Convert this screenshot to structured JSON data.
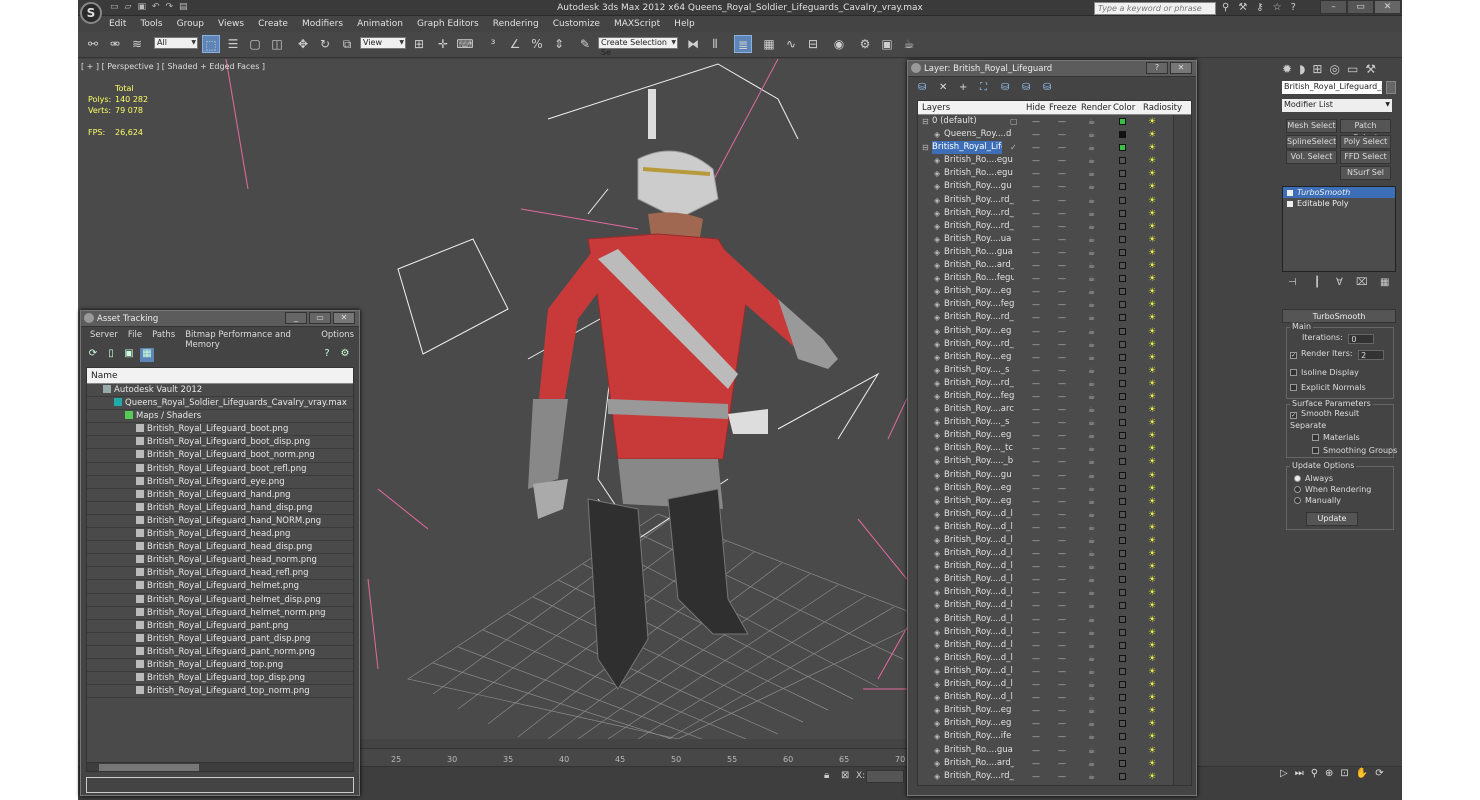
{
  "app": {
    "title": "Autodesk 3ds Max  2012 x64     Queens_Royal_Soldier_Lifeguards_Cavalry_vray.max",
    "search_placeholder": "Type a keyword or phrase",
    "menu": [
      "Edit",
      "Tools",
      "Group",
      "Views",
      "Create",
      "Modifiers",
      "Animation",
      "Graph Editors",
      "Rendering",
      "Customize",
      "MAXScript",
      "Help"
    ]
  },
  "toolbar": {
    "filter_value": "All",
    "refcoord_value": "View",
    "selection_set_value": "Create Selection Se"
  },
  "viewport": {
    "label": "[ + ] [ Perspective ] [ Shaded + Edged Faces ]",
    "stats": {
      "total_label": "Total",
      "polys_label": "Polys:",
      "polys_value": "140 282",
      "verts_label": "Verts:",
      "verts_value": "79 078",
      "fps_label": "FPS:",
      "fps_value": "26,624"
    }
  },
  "trackbar": {
    "ticks": [
      "25",
      "30",
      "35",
      "40",
      "45",
      "50",
      "55",
      "60",
      "65",
      "70",
      "75"
    ]
  },
  "statusbar": {
    "x_label": "X:",
    "y_label": "Y:",
    "z_label": "Z:"
  },
  "asset_tracking": {
    "title": "Asset Tracking",
    "menu": [
      "Server",
      "File",
      "Paths",
      "Bitmap Performance and Memory",
      "Options"
    ],
    "column_header": "Name",
    "vault": "Autodesk Vault 2012",
    "scene_file": "Queens_Royal_Soldier_Lifeguards_Cavalry_vray.max",
    "maps_folder": "Maps / Shaders",
    "files": [
      "British_Royal_Lifeguard_boot.png",
      "British_Royal_Lifeguard_boot_disp.png",
      "British_Royal_Lifeguard_boot_norm.png",
      "British_Royal_Lifeguard_boot_refl.png",
      "British_Royal_Lifeguard_eye.png",
      "British_Royal_Lifeguard_hand.png",
      "British_Royal_Lifeguard_hand_disp.png",
      "British_Royal_Lifeguard_hand_NORM.png",
      "British_Royal_Lifeguard_head.png",
      "British_Royal_Lifeguard_head_disp.png",
      "British_Royal_Lifeguard_head_norm.png",
      "British_Royal_Lifeguard_head_refl.png",
      "British_Royal_Lifeguard_helmet.png",
      "British_Royal_Lifeguard_helmet_disp.png",
      "British_Royal_Lifeguard_helmet_norm.png",
      "British_Royal_Lifeguard_pant.png",
      "British_Royal_Lifeguard_pant_disp.png",
      "British_Royal_Lifeguard_pant_norm.png",
      "British_Royal_Lifeguard_top.png",
      "British_Royal_Lifeguard_top_disp.png",
      "British_Royal_Lifeguard_top_norm.png"
    ]
  },
  "layer_window": {
    "title": "Layer: British_Royal_Lifeguard",
    "columns": {
      "layers": "Layers",
      "hide": "Hide",
      "freeze": "Freeze",
      "render": "Render",
      "color": "Color",
      "radiosity": "Radiosity"
    },
    "rows": [
      "0 (default)",
      "Queens_Roy....d",
      "British_Royal_Lifeg",
      "British_Ro....egu",
      "British_Ro....egu",
      "British_Roy....gu",
      "British_Roy....rd_",
      "British_Roy....rd_",
      "British_Roy....rd_",
      "British_Roy....ua",
      "British_Ro....gua",
      "British_Ro....ard_",
      "British_Ro....fegu",
      "British_Roy....eg",
      "British_Roy....feg",
      "British_Roy....rd_",
      "British_Roy....eg",
      "British_Roy....rd_",
      "British_Roy....eg",
      "British_Roy...._s",
      "British_Roy....rd_",
      "British_Roy....feg",
      "British_Roy....arc",
      "British_Roy...._s",
      "British_Roy....eg",
      "British_Roy...._tc",
      "British_Roy....._b",
      "British_Roy....gu",
      "British_Roy....eg",
      "British_Roy....eg",
      "British_Roy....d_l",
      "British_Roy....d_l",
      "British_Roy....d_l",
      "British_Roy....d_l",
      "British_Roy....d_l",
      "British_Roy....d_l",
      "British_Roy....d_l",
      "British_Roy....d_l",
      "British_Roy....d_l",
      "British_Roy....d_l",
      "British_Roy....d_l",
      "British_Roy....d_l",
      "British_Roy....d_l",
      "British_Roy....d_l",
      "British_Roy....d_l",
      "British_Roy....eg",
      "British_Roy....eg",
      "British_Roy....ife",
      "British_Ro....gua",
      "British_Ro....ard_",
      "British_Roy....rd_"
    ]
  },
  "command_panel": {
    "object_name": "British_Royal_Lifeguard_sabe",
    "modifier_list": "Modifier List",
    "buttons": [
      "Mesh Select",
      "Patch Select",
      "SplineSelect",
      "Poly Select",
      "Vol. Select",
      "FFD Select",
      "NSurf Sel"
    ],
    "stack": [
      "TurboSmooth",
      "Editable Poly"
    ],
    "rollout_title": "TurboSmooth",
    "main_label": "Main",
    "iterations_label": "Iterations:",
    "iterations_value": "0",
    "render_iters_label": "Render Iters:",
    "render_iters_value": "2",
    "isoline_label": "Isoline Display",
    "explicit_normals_label": "Explicit Normals",
    "surface_params_label": "Surface Parameters",
    "smooth_result_label": "Smooth Result",
    "separate_label": "Separate",
    "materials_label": "Materials",
    "smoothing_groups_label": "Smoothing Groups",
    "update_options_label": "Update Options",
    "always_label": "Always",
    "when_rendering_label": "When Rendering",
    "manually_label": "Manually",
    "update_button": "Update"
  }
}
